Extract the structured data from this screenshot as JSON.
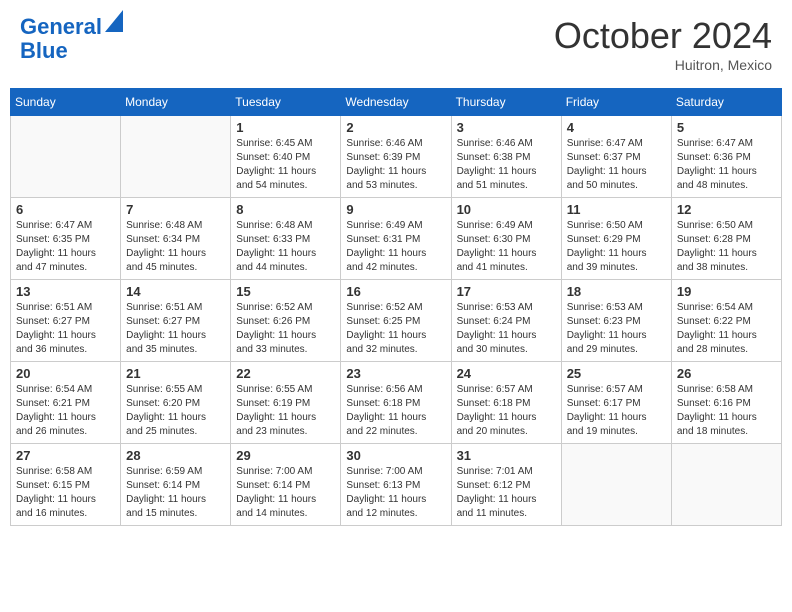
{
  "header": {
    "logo_line1": "General",
    "logo_line2": "Blue",
    "month": "October 2024",
    "location": "Huitron, Mexico"
  },
  "days_of_week": [
    "Sunday",
    "Monday",
    "Tuesday",
    "Wednesday",
    "Thursday",
    "Friday",
    "Saturday"
  ],
  "weeks": [
    [
      {
        "day": "",
        "info": ""
      },
      {
        "day": "",
        "info": ""
      },
      {
        "day": "1",
        "info": "Sunrise: 6:45 AM\nSunset: 6:40 PM\nDaylight: 11 hours and 54 minutes."
      },
      {
        "day": "2",
        "info": "Sunrise: 6:46 AM\nSunset: 6:39 PM\nDaylight: 11 hours and 53 minutes."
      },
      {
        "day": "3",
        "info": "Sunrise: 6:46 AM\nSunset: 6:38 PM\nDaylight: 11 hours and 51 minutes."
      },
      {
        "day": "4",
        "info": "Sunrise: 6:47 AM\nSunset: 6:37 PM\nDaylight: 11 hours and 50 minutes."
      },
      {
        "day": "5",
        "info": "Sunrise: 6:47 AM\nSunset: 6:36 PM\nDaylight: 11 hours and 48 minutes."
      }
    ],
    [
      {
        "day": "6",
        "info": "Sunrise: 6:47 AM\nSunset: 6:35 PM\nDaylight: 11 hours and 47 minutes."
      },
      {
        "day": "7",
        "info": "Sunrise: 6:48 AM\nSunset: 6:34 PM\nDaylight: 11 hours and 45 minutes."
      },
      {
        "day": "8",
        "info": "Sunrise: 6:48 AM\nSunset: 6:33 PM\nDaylight: 11 hours and 44 minutes."
      },
      {
        "day": "9",
        "info": "Sunrise: 6:49 AM\nSunset: 6:31 PM\nDaylight: 11 hours and 42 minutes."
      },
      {
        "day": "10",
        "info": "Sunrise: 6:49 AM\nSunset: 6:30 PM\nDaylight: 11 hours and 41 minutes."
      },
      {
        "day": "11",
        "info": "Sunrise: 6:50 AM\nSunset: 6:29 PM\nDaylight: 11 hours and 39 minutes."
      },
      {
        "day": "12",
        "info": "Sunrise: 6:50 AM\nSunset: 6:28 PM\nDaylight: 11 hours and 38 minutes."
      }
    ],
    [
      {
        "day": "13",
        "info": "Sunrise: 6:51 AM\nSunset: 6:27 PM\nDaylight: 11 hours and 36 minutes."
      },
      {
        "day": "14",
        "info": "Sunrise: 6:51 AM\nSunset: 6:27 PM\nDaylight: 11 hours and 35 minutes."
      },
      {
        "day": "15",
        "info": "Sunrise: 6:52 AM\nSunset: 6:26 PM\nDaylight: 11 hours and 33 minutes."
      },
      {
        "day": "16",
        "info": "Sunrise: 6:52 AM\nSunset: 6:25 PM\nDaylight: 11 hours and 32 minutes."
      },
      {
        "day": "17",
        "info": "Sunrise: 6:53 AM\nSunset: 6:24 PM\nDaylight: 11 hours and 30 minutes."
      },
      {
        "day": "18",
        "info": "Sunrise: 6:53 AM\nSunset: 6:23 PM\nDaylight: 11 hours and 29 minutes."
      },
      {
        "day": "19",
        "info": "Sunrise: 6:54 AM\nSunset: 6:22 PM\nDaylight: 11 hours and 28 minutes."
      }
    ],
    [
      {
        "day": "20",
        "info": "Sunrise: 6:54 AM\nSunset: 6:21 PM\nDaylight: 11 hours and 26 minutes."
      },
      {
        "day": "21",
        "info": "Sunrise: 6:55 AM\nSunset: 6:20 PM\nDaylight: 11 hours and 25 minutes."
      },
      {
        "day": "22",
        "info": "Sunrise: 6:55 AM\nSunset: 6:19 PM\nDaylight: 11 hours and 23 minutes."
      },
      {
        "day": "23",
        "info": "Sunrise: 6:56 AM\nSunset: 6:18 PM\nDaylight: 11 hours and 22 minutes."
      },
      {
        "day": "24",
        "info": "Sunrise: 6:57 AM\nSunset: 6:18 PM\nDaylight: 11 hours and 20 minutes."
      },
      {
        "day": "25",
        "info": "Sunrise: 6:57 AM\nSunset: 6:17 PM\nDaylight: 11 hours and 19 minutes."
      },
      {
        "day": "26",
        "info": "Sunrise: 6:58 AM\nSunset: 6:16 PM\nDaylight: 11 hours and 18 minutes."
      }
    ],
    [
      {
        "day": "27",
        "info": "Sunrise: 6:58 AM\nSunset: 6:15 PM\nDaylight: 11 hours and 16 minutes."
      },
      {
        "day": "28",
        "info": "Sunrise: 6:59 AM\nSunset: 6:14 PM\nDaylight: 11 hours and 15 minutes."
      },
      {
        "day": "29",
        "info": "Sunrise: 7:00 AM\nSunset: 6:14 PM\nDaylight: 11 hours and 14 minutes."
      },
      {
        "day": "30",
        "info": "Sunrise: 7:00 AM\nSunset: 6:13 PM\nDaylight: 11 hours and 12 minutes."
      },
      {
        "day": "31",
        "info": "Sunrise: 7:01 AM\nSunset: 6:12 PM\nDaylight: 11 hours and 11 minutes."
      },
      {
        "day": "",
        "info": ""
      },
      {
        "day": "",
        "info": ""
      }
    ]
  ]
}
